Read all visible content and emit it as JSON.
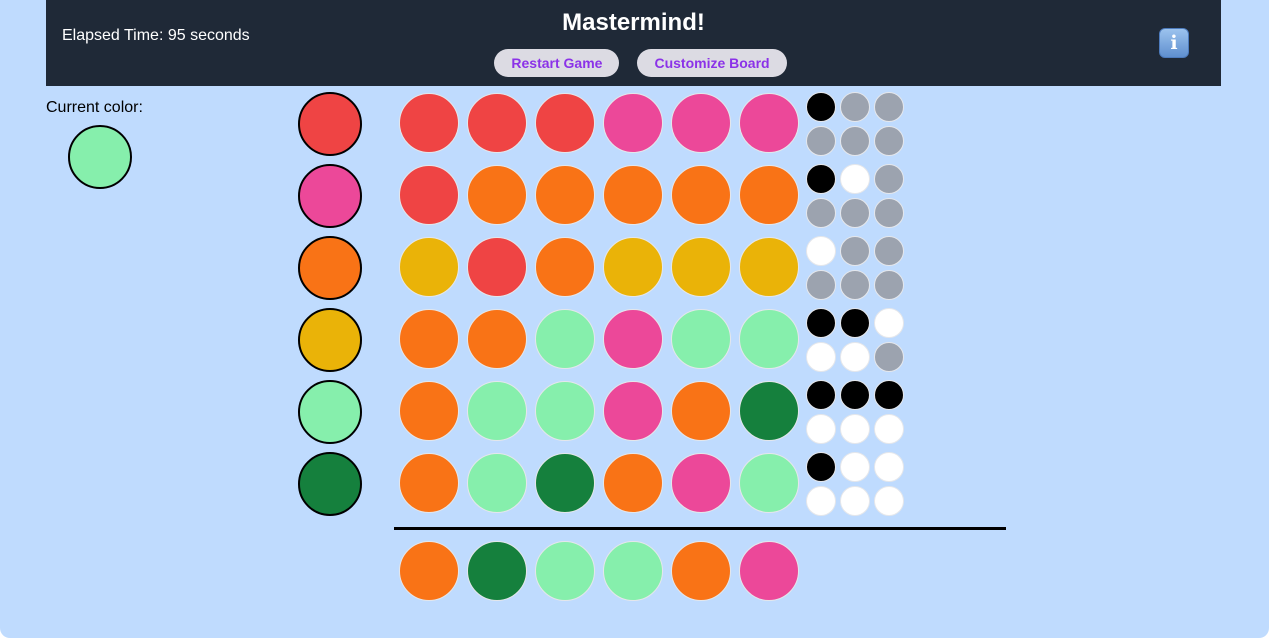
{
  "header": {
    "elapsed_text": "Elapsed Time: 95 seconds",
    "title": "Mastermind!",
    "restart_label": "Restart Game",
    "customize_label": "Customize Board",
    "info_icon": "information-icon",
    "info_glyph": "i"
  },
  "current": {
    "label": "Current color:",
    "color": "#86efac"
  },
  "colors": {
    "red": "#ef4444",
    "pink": "#ec4899",
    "orange": "#f97316",
    "yellow": "#eab308",
    "lightgreen": "#86efac",
    "darkgreen": "#15803d",
    "black": "#000000",
    "white": "#ffffff",
    "empty": "#9ca3af"
  },
  "palette": [
    "red",
    "pink",
    "orange",
    "yellow",
    "lightgreen",
    "darkgreen"
  ],
  "guesses": [
    {
      "pegs": [
        "red",
        "red",
        "red",
        "pink",
        "pink",
        "pink"
      ],
      "feedback": [
        "black",
        "empty",
        "empty",
        "empty",
        "empty",
        "empty"
      ]
    },
    {
      "pegs": [
        "red",
        "orange",
        "orange",
        "orange",
        "orange",
        "orange"
      ],
      "feedback": [
        "black",
        "white",
        "empty",
        "empty",
        "empty",
        "empty"
      ]
    },
    {
      "pegs": [
        "yellow",
        "red",
        "orange",
        "yellow",
        "yellow",
        "yellow"
      ],
      "feedback": [
        "white",
        "empty",
        "empty",
        "empty",
        "empty",
        "empty"
      ]
    },
    {
      "pegs": [
        "orange",
        "orange",
        "lightgreen",
        "pink",
        "lightgreen",
        "lightgreen"
      ],
      "feedback": [
        "black",
        "black",
        "white",
        "white",
        "white",
        "empty"
      ]
    },
    {
      "pegs": [
        "orange",
        "lightgreen",
        "lightgreen",
        "pink",
        "orange",
        "darkgreen"
      ],
      "feedback": [
        "black",
        "black",
        "black",
        "white",
        "white",
        "white"
      ]
    },
    {
      "pegs": [
        "orange",
        "lightgreen",
        "darkgreen",
        "orange",
        "pink",
        "lightgreen"
      ],
      "feedback": [
        "black",
        "white",
        "white",
        "white",
        "white",
        "white"
      ]
    }
  ],
  "secret": [
    "orange",
    "darkgreen",
    "lightgreen",
    "lightgreen",
    "orange",
    "pink"
  ]
}
